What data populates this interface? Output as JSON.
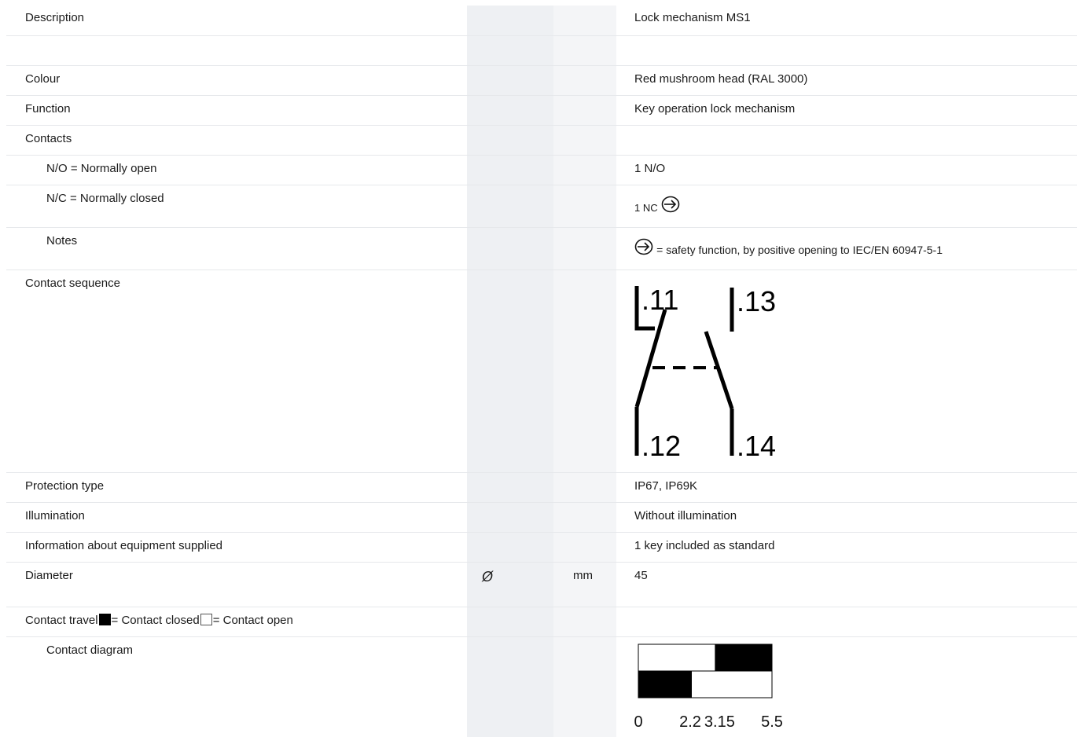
{
  "rows": {
    "description": {
      "label": "Description",
      "value": "Lock mechanism MS1"
    },
    "colour": {
      "label": "Colour",
      "value": "Red mushroom head (RAL 3000)"
    },
    "function": {
      "label": "Function",
      "value": "Key operation lock mechanism"
    },
    "contacts": {
      "label": "Contacts"
    },
    "no": {
      "label": "N/O = Normally open",
      "value": "1 N/O"
    },
    "nc": {
      "label": "N/C = Normally closed",
      "value": "1 NC"
    },
    "notes": {
      "label": "Notes",
      "value": "= safety function, by positive opening to IEC/EN 60947-5-1"
    },
    "contact_sequence": {
      "label": "Contact sequence",
      "terminals": [
        ".11",
        ".13",
        ".12",
        ".14"
      ]
    },
    "protection": {
      "label": "Protection type",
      "value": "IP67, IP69K"
    },
    "illumination": {
      "label": "Illumination",
      "value": "Without illumination"
    },
    "equipment": {
      "label": "Information about equipment supplied",
      "value": "1 key included as standard"
    },
    "diameter": {
      "label": "Diameter",
      "symbol": "Ø",
      "unit": "mm",
      "value": "45"
    },
    "travel": {
      "label_prefix": "Contact travel",
      "closed_text": "= Contact closed",
      "open_text": "= Contact open"
    },
    "contact_diagram": {
      "label": "Contact diagram",
      "ticks": [
        "0",
        "2.2",
        "3.15",
        "5.5"
      ],
      "tick_values": [
        0,
        2.2,
        3.15,
        5.5
      ],
      "top_contact_closed_from": 3.15,
      "bottom_contact_closed_until": 2.2
    }
  },
  "icons": {
    "positive_opening": "circle-arrow-icon"
  }
}
